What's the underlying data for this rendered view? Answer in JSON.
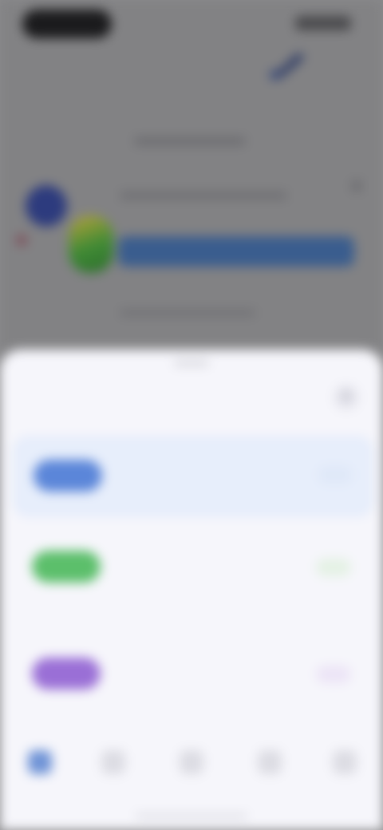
{
  "sheet": {
    "title": "",
    "close_glyph": "✕"
  },
  "options": [
    {
      "name": "",
      "description": "",
      "icon": "blue-icon",
      "selected": true
    },
    {
      "name": "",
      "description": "",
      "icon": "green-icon",
      "selected": false
    },
    {
      "name": "",
      "description": "",
      "icon": "purple-icon",
      "selected": false
    }
  ],
  "tabs": [
    {
      "label": "",
      "icon": "home-icon",
      "active": true
    },
    {
      "label": "",
      "icon": "search-icon",
      "active": false
    },
    {
      "label": "",
      "icon": "add-icon",
      "active": false
    },
    {
      "label": "",
      "icon": "notifications-icon",
      "active": false
    },
    {
      "label": "",
      "icon": "profile-icon",
      "active": false
    }
  ],
  "colors": {
    "accent_blue": "#3a67c4",
    "option_blue": "#5b86d9",
    "option_green": "#5cbf6b",
    "option_purple": "#9a6fd6",
    "sheet_background": "#f6f6fb",
    "dim_overlay": "#828284"
  }
}
